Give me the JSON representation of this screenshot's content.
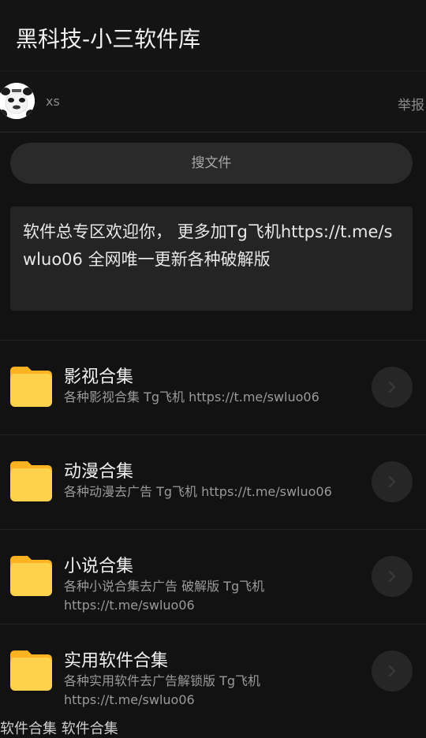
{
  "header": {
    "title": "黑科技-小三软件库"
  },
  "user": {
    "name": "xs",
    "report_label": "举报",
    "avatar_icon": "panda-meme-avatar-icon"
  },
  "search": {
    "label": "搜文件"
  },
  "notice": {
    "text": "软件总专区欢迎你， 更多加Tg飞机https://t.me/swluo06 全网唯一更新各种破解版"
  },
  "folders": [
    {
      "name": "影视合集",
      "desc": "各种影视合集 Tg飞机 https://t.me/swluo06",
      "icon": "folder-icon"
    },
    {
      "name": "动漫合集",
      "desc": "各种动漫去广告 Tg飞机 https://t.me/swluo06",
      "icon": "folder-icon"
    },
    {
      "name": "小说合集",
      "desc": "各种小说合集去广告 破解版 Tg飞机 https://t.me/swluo06",
      "icon": "folder-icon"
    },
    {
      "name": "实用软件合集",
      "desc": "各种实用软件去广告解锁版 Tg飞机 https://t.me/swluo06",
      "icon": "folder-icon"
    }
  ],
  "partial_next_row": "软件合集 软件合集",
  "colors": {
    "background": "#121212",
    "card": "#242424",
    "folder_yellow": "#ffd24d",
    "folder_tab": "#ffb321"
  }
}
